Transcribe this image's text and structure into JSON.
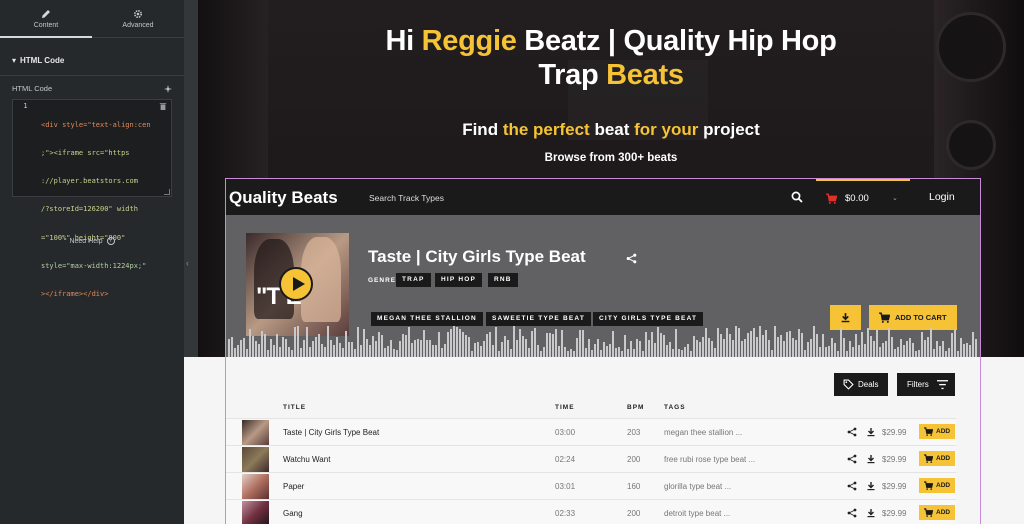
{
  "editor": {
    "tabs": [
      {
        "label": "Content",
        "icon": "pencil-icon"
      },
      {
        "label": "Advanced",
        "icon": "gear-icon"
      }
    ],
    "section_title": "HTML Code",
    "field_label": "HTML Code",
    "line_number": "1",
    "code_lines": [
      "<div style=\"text-align:cen",
      ";\"><iframe src=\"https",
      "://player.beatstors.com",
      "/?storeId=126200\" width",
      "=\"100%\" height=\"800\"",
      "style=\"max-width:1224px;\"",
      "></iframe></div>"
    ],
    "need_help": "Need Help"
  },
  "hero": {
    "title_line1_a": "Hi ",
    "title_line1_b": "Reggie",
    "title_line1_c": " Beatz | Quality Hip Hop",
    "title_line2_a": "Trap ",
    "title_line2_b": "Beats",
    "sub_a": "Find ",
    "sub_b": "the perfect",
    "sub_c": " beat ",
    "sub_d": "for your",
    "sub_e": " project",
    "browse": "Browse from 300+ beats",
    "accent": "#f5c335"
  },
  "store": {
    "brand": "Quality Beats",
    "search_placeholder": "Search Track Types",
    "cart_total": "$0.00",
    "login": "Login"
  },
  "player": {
    "cover_text": "\"T  E\"",
    "title": "Taste | City Girls Type Beat",
    "genre_label": "GENRE",
    "genres": [
      "TRAP",
      "HIP HOP",
      "RNB"
    ],
    "tags": [
      "MEGAN THEE STALLION",
      "SAWEETIE TYPE BEAT",
      "CITY GIRLS TYPE BEAT"
    ],
    "add_to_cart": "ADD TO CART"
  },
  "list": {
    "deals": "Deals",
    "filters": "Filters",
    "headers": {
      "title": "TITLE",
      "time": "TIME",
      "bpm": "BPM",
      "tags": "TAGS"
    },
    "rows": [
      {
        "title": "Taste | City Girls Type Beat",
        "time": "03:00",
        "bpm": "203",
        "tags": "megan thee stallion ...",
        "price": "$29.99",
        "add": "ADD"
      },
      {
        "title": "Watchu Want",
        "time": "02:24",
        "bpm": "200",
        "tags": "free rubi rose type beat ...",
        "price": "$29.99",
        "add": "ADD"
      },
      {
        "title": "Paper",
        "time": "03:01",
        "bpm": "160",
        "tags": "glorilla type beat ...",
        "price": "$29.99",
        "add": "ADD"
      },
      {
        "title": "Gang",
        "time": "02:33",
        "bpm": "200",
        "tags": "detroit type beat ...",
        "price": "$29.99",
        "add": "ADD"
      }
    ]
  }
}
